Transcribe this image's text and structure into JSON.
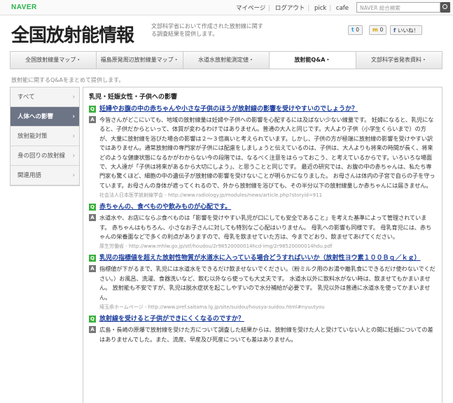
{
  "top": {
    "logo": "NAVER",
    "links": [
      "マイページ",
      "ログアウト",
      "pick",
      "cafe"
    ],
    "search_placeholder": "NAVER 総合検索"
  },
  "header": {
    "title": "全国放射能情報",
    "description": "文部科学省において作成された放射線に関する調査結果を提供します。",
    "social": [
      "0",
      "0",
      "いいね！"
    ]
  },
  "nav": {
    "tabs": [
      "全国放射線量マップ・",
      "福島原発周辺放射線量マップ・",
      "水道水放射能測定値・",
      "放射能Q&A・",
      "文部科学省発表資料・"
    ]
  },
  "subtitle": "放射能に関するQ&Aをまとめて提供します。",
  "sidebar": {
    "items": [
      "すべて",
      "人体への影響",
      "放射能対策",
      "身の回りの放射線",
      "関連用語"
    ]
  },
  "content": {
    "section_title": "乳児・妊娠女性・子供への影響",
    "entries": [
      {
        "q": "妊婦やお腹の中の赤ちゃんや小さな子供のほうが放射線の影響を受けやすいのでしょうか？",
        "a": "今皆さんがどこにいても、地域の放射線量は妊婦や子供への影響を心配するには及ばない少ない線量です。 妊婦になると、乳児になると、子供だからといって、体質が変わるわけではありません。普通の大人と同じです。大人より子供（小学生くらいまで）の方が、大量に放射線を浴びた場合の影響は２～３倍高いと考えられています。しかし、子供の方が極端に放射線の影響を受けやすい訳ではありません。通常放射線の専門家が子供には配慮をしましょうと伝えているのは、子供は、大人よりも将来の時間が長く、将来どのような健康状態になるかがわからない今の段階では、なるべく注意をはらっておこう、と考えているからです。いろいろな場面で、大人達が「子供は将来があるから大切にしよう」、と思うことと同じです。 最近の研究では、お腹の中の赤ちゃんは、私たち専門家も驚くほど、細胞の中の遺伝子が放射線の影響を受けないことが明らかになりました。 お母さんは体内の子宮で自らの子を守っています。お母さんの身体が遮ってくれるので、外から放射線を浴びても、その半分以下の放射線量しか赤ちゃんには届きません。",
        "src": "社会法人日本医学放射線学会 - http://www.radiology.jp/modules/news/article.php?storyid=911"
      },
      {
        "q": "赤ちゃんの、食べものや飲みものが心配です。",
        "a": "水道水や、お店にならぶ食べものは「影響を受けやすい乳児が口にしても安全であること」を考えた基準によって管理されています。 赤ちゃんはもちろん、小さなお子さんに対しても特別なご心配はいりません。 母乳への影響も同様です。 母乳育児には、赤ちゃんの栄養面などで多くの利点がありますので、母乳を飲ませていた方は、今までどおり、飲ませてあげてください。",
        "src": "厚生労働省 - http://www.mhlw.go.jp/stf/houdou/2r98520000014hcd-img/2r98520000014hdu.pdf"
      },
      {
        "q": "乳児の指標値を超えた放射性物質が水道水に入っている場合どうすればいいか（放射性ヨウ素１００Ｂｑ／ｋｇ）",
        "a": "指標値が下がるまで、乳児には水道水をできるだけ飲ませないでください。（粉ミルク用のお湯や離乳食にできるだけ使わないでください。）お風呂、洗濯、食器洗いなど、飲む以外なら使っても大丈夫です。 水道水以外に飲料水がない時は、飲ませてもかまいません。 放射能も不安ですが、乳児は脱水症状を起こしやすいので水分補給が必要です。 乳児以外は普通に水道水を使ってかまいません。",
        "src": "埼玉県ホームページ - http://www.pref.saitama.lg.jp/site/suidou/housya-suidou.html#nyuutyou"
      },
      {
        "q": "放射線を受けると子供ができにくくなるのですか？",
        "a": "広島・長崎の原爆で放射線を受けた方について調査した結果からは、放射線を受けた人と受けていない人との間に妊娠についての差はありませんでした。また、流産、早産及び死産についても差はありません。",
        "src": ""
      }
    ]
  }
}
